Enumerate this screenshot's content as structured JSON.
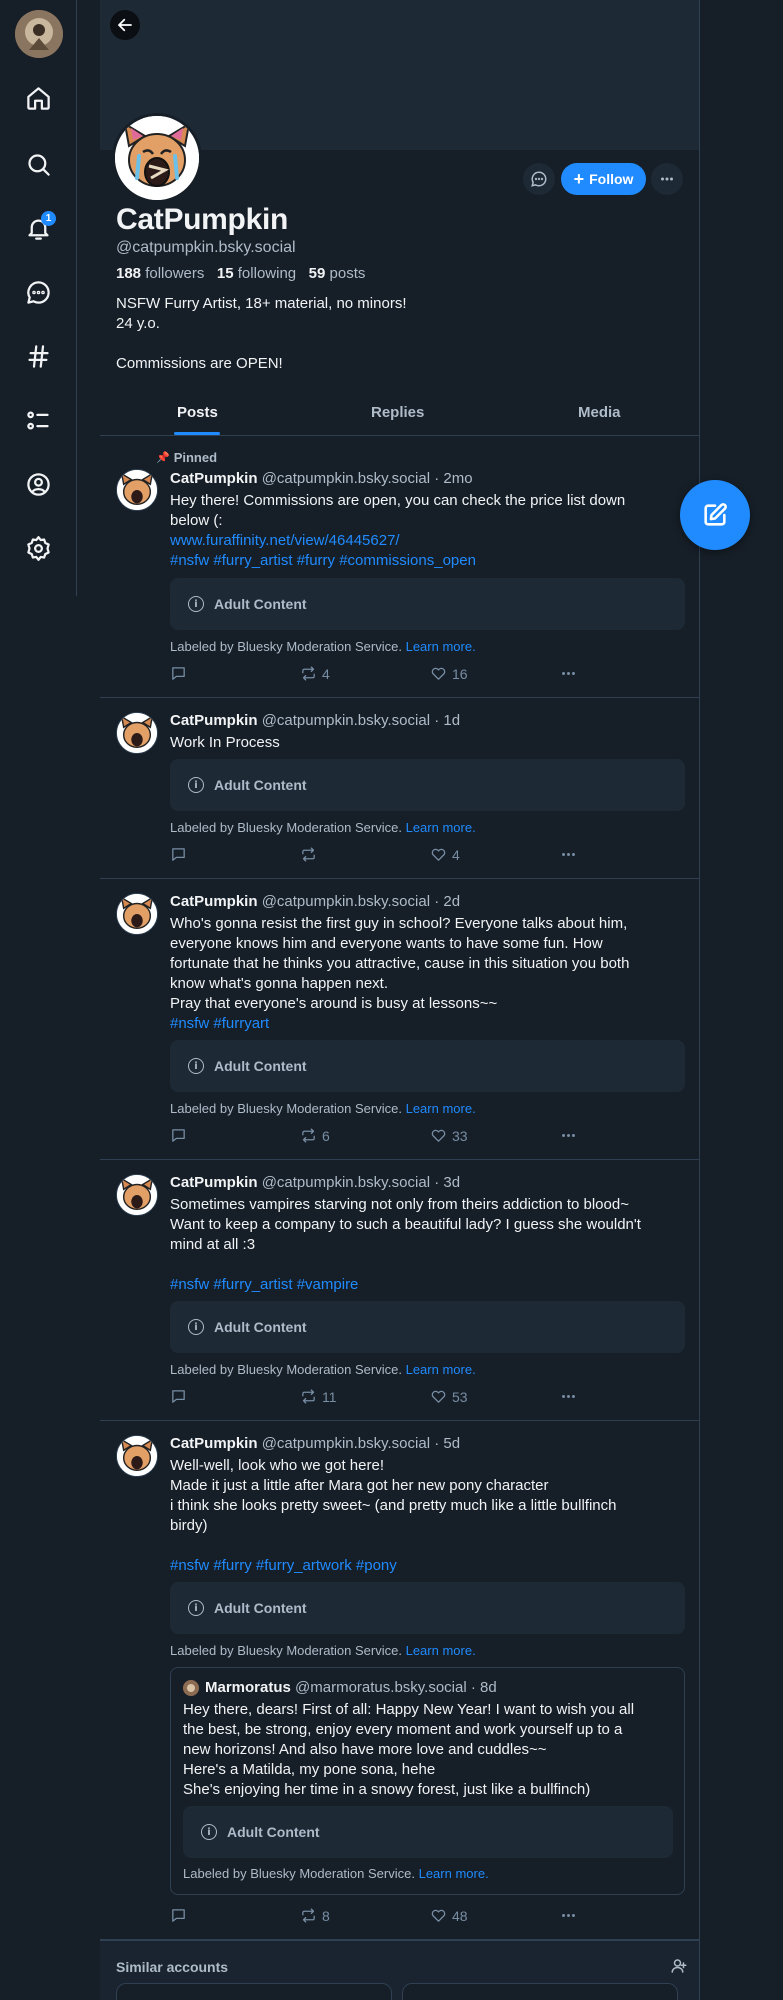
{
  "nav": {
    "notifications_badge": "1"
  },
  "profile": {
    "display_name": "CatPumpkin",
    "handle": "@catpumpkin.bsky.social",
    "followers_count": "188",
    "followers_label": "followers",
    "following_count": "15",
    "following_label": "following",
    "posts_count": "59",
    "posts_label": "posts",
    "bio_line1": "NSFW Furry Artist, 18+ material, no minors!",
    "bio_line2": "24 y.o.",
    "bio_line3": "Commissions are OPEN!",
    "follow_label": "Follow"
  },
  "tabs": [
    {
      "label": "Posts",
      "active": true
    },
    {
      "label": "Replies",
      "active": false
    },
    {
      "label": "Media",
      "active": false
    }
  ],
  "moderation": {
    "adult_content": "Adult Content",
    "labeled_text": "Labeled by Bluesky Moderation Service.",
    "learn_more": "Learn more."
  },
  "posts": [
    {
      "pinned_label": "Pinned",
      "name": "CatPumpkin",
      "meta": "@catpumpkin.bsky.social · 2mo",
      "text_line1": "Hey there! Commissions are open, you can check the price list down",
      "text_line2": "below (:",
      "link": "www.furaffinity.net/view/46445627/",
      "tags": "#nsfw #furry_artist #furry #commissions_open",
      "reposts": "4",
      "likes": "16"
    },
    {
      "name": "CatPumpkin",
      "meta": "@catpumpkin.bsky.social · 1d",
      "text_line1": "Work In Process",
      "reposts": "",
      "likes": "4"
    },
    {
      "name": "CatPumpkin",
      "meta": "@catpumpkin.bsky.social · 2d",
      "text_line1": "Who's gonna resist the first guy in school? Everyone talks about him,",
      "text_line2": "everyone knows him and everyone wants to have some fun. How",
      "text_line3": "fortunate that he thinks you attractive, cause in this situation you both",
      "text_line4": "know what's gonna happen next.",
      "text_line5": "Pray that everyone's around is busy at lessons~~",
      "tags": "#nsfw #furryart",
      "reposts": "6",
      "likes": "33"
    },
    {
      "name": "CatPumpkin",
      "meta": "@catpumpkin.bsky.social · 3d",
      "text_line1": "Sometimes vampires starving not only from theirs addiction to blood~",
      "text_line2": "Want to keep a company to such a beautiful lady? I guess she wouldn't",
      "text_line3": "mind at all :3",
      "tags": "#nsfw #furry_artist #vampire",
      "reposts": "11",
      "likes": "53"
    },
    {
      "name": "CatPumpkin",
      "meta": "@catpumpkin.bsky.social · 5d",
      "text_line1": "Well-well, look who we got here!",
      "text_line2": "Made it just a little after Mara got her new pony character",
      "text_line3": "i think she looks pretty sweet~ (and pretty much like a little bullfinch",
      "text_line4": "birdy)",
      "tags": "#nsfw #furry #furry_artwork #pony",
      "reposts": "8",
      "likes": "48",
      "quote": {
        "name": "Marmoratus",
        "meta": "@marmoratus.bsky.social · 8d",
        "text_line1": "Hey there, dears! First of all: Happy New Year! I want to wish you all",
        "text_line2": "the best, be strong, enjoy every moment and work yourself up to a",
        "text_line3": "new horizons! And also have more love and cuddles~~",
        "text_line4": "Here's a Matilda, my pone sona, hehe",
        "text_line5": "She's enjoying her time in a snowy forest, just like a bullfinch)"
      }
    }
  ],
  "similar": {
    "title": "Similar accounts"
  },
  "colors": {
    "background": "#161e27",
    "accent": "#208bfe",
    "muted_text": "#aebbc9",
    "surface": "#1e2936"
  }
}
